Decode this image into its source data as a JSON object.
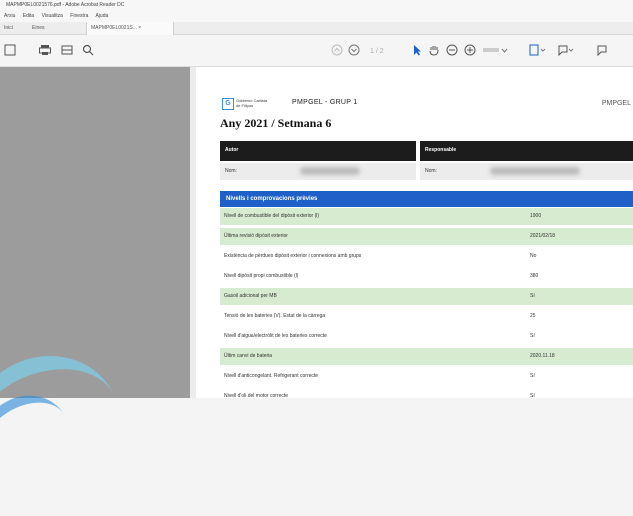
{
  "window": {
    "title": "MAPMP0EL0021576.pdf - Adobe Acrobat Reader DC"
  },
  "menu": [
    "Arxiu",
    "Edita",
    "Visualitza",
    "Finestra",
    "Ajuda"
  ],
  "tabs": [
    "Inici",
    "Eines",
    "MAPMP0EL0021S..."
  ],
  "toolbar": {
    "left_icons": [
      "save-icon",
      "print-icon",
      "email-icon",
      "search-icon"
    ],
    "right_icons": [
      "up-icon",
      "down-icon",
      "page-icon",
      "cursor-icon",
      "hand-icon",
      "zoom-out-icon",
      "zoom-in-icon",
      "zoom-level-icon",
      "fit-icon",
      "comment-icon",
      "annotate-icon"
    ]
  },
  "document": {
    "logo_text": "Gobierno Carlista de Filipos",
    "doc_title": "PMPGEL - GRUP 1",
    "doc_code": "PMPGEL",
    "heading": "Any 2021 / Setmana 6",
    "author_header": "Autor",
    "responsible_header": "Responsable",
    "name_label": "Nom:",
    "name_label2": "Nom:",
    "section_title": "Nivells i comprovacions prèvies",
    "rows": [
      {
        "label": "Nivell de combustible del dipòsit exterior (l)",
        "value": "1900",
        "green": true
      },
      {
        "label": "Última revisió dipòsit exterior",
        "value": "2021/02/18",
        "green": true
      },
      {
        "label": "Existència de pèrdues dipòsit exterior i connexions amb grups",
        "value": "No",
        "green": false
      },
      {
        "label": "Nivell dipòsit propi combustible (l)",
        "value": "380",
        "green": false
      },
      {
        "label": "Gasoil adicional per MB",
        "value": "Sí",
        "green": true
      },
      {
        "label": "Tensió de les bateries (V). Estat de la càrrega",
        "value": "25",
        "green": false
      },
      {
        "label": "Nivell d'aigua/electròlit de les bateries correcte",
        "value": "Sí",
        "green": false
      },
      {
        "label": "Últim canvi de bateria",
        "value": "2020.11.18",
        "green": true
      },
      {
        "label": "Nivell d'anticongelant. Refrigerant correcte",
        "value": "Sí",
        "green": false
      },
      {
        "label": "Nivell d'oli del motor correcte",
        "value": "Sí",
        "green": false
      }
    ]
  }
}
